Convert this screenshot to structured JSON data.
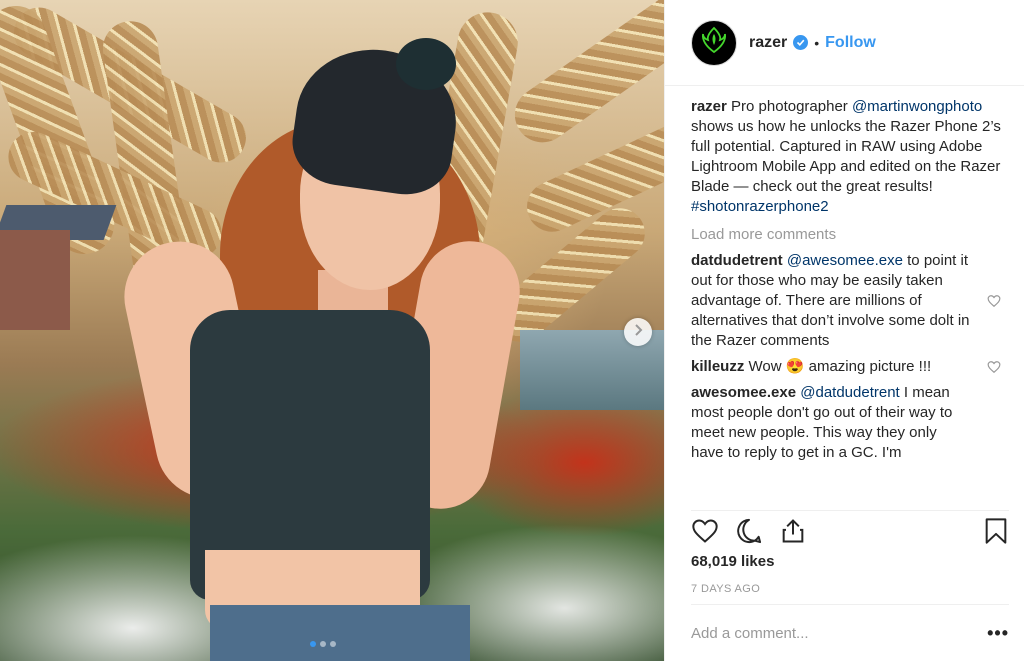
{
  "post": {
    "image_alt": "",
    "carousel_dots": 3
  },
  "header": {
    "username": "razer",
    "separator": "•",
    "follow_label": "Follow"
  },
  "caption": {
    "username": "razer",
    "text_1": " Pro photographer ",
    "mention": "@martinwongphoto",
    "text_2": " shows us how he unlocks the Razer Phone 2’s full potential. Captured in RAW using Adobe Lightroom Mobile App and edited on the Razer Blade — check out the great results! ",
    "hashtag": "#shotonrazerphone2"
  },
  "load_more_label": "Load more comments",
  "comments": [
    {
      "username": "datdudetrent",
      "mention": "@awesomee.exe",
      "text": " to point it out for those who may be easily taken advantage of. There are millions of alternatives that don’t involve some dolt in the Razer comments"
    },
    {
      "username": "killeuzz",
      "text_before": " Wow ",
      "emoji": "😍",
      "text_after": "  amazing picture !!!"
    },
    {
      "username": "awesomee.exe",
      "mention": "@datdudetrent",
      "text": " I mean most people don't go out of their way to meet new people. This way they only have to reply to get in a GC. I'm"
    }
  ],
  "likes_label": "68,019 likes",
  "timestamp": "7 DAYS AGO",
  "add_comment_placeholder": "Add a comment...",
  "more_options": "•••",
  "colors": {
    "link_blue": "#3897f0",
    "mention": "#003569",
    "muted": "#999999",
    "razer_green": "#44d62c"
  }
}
